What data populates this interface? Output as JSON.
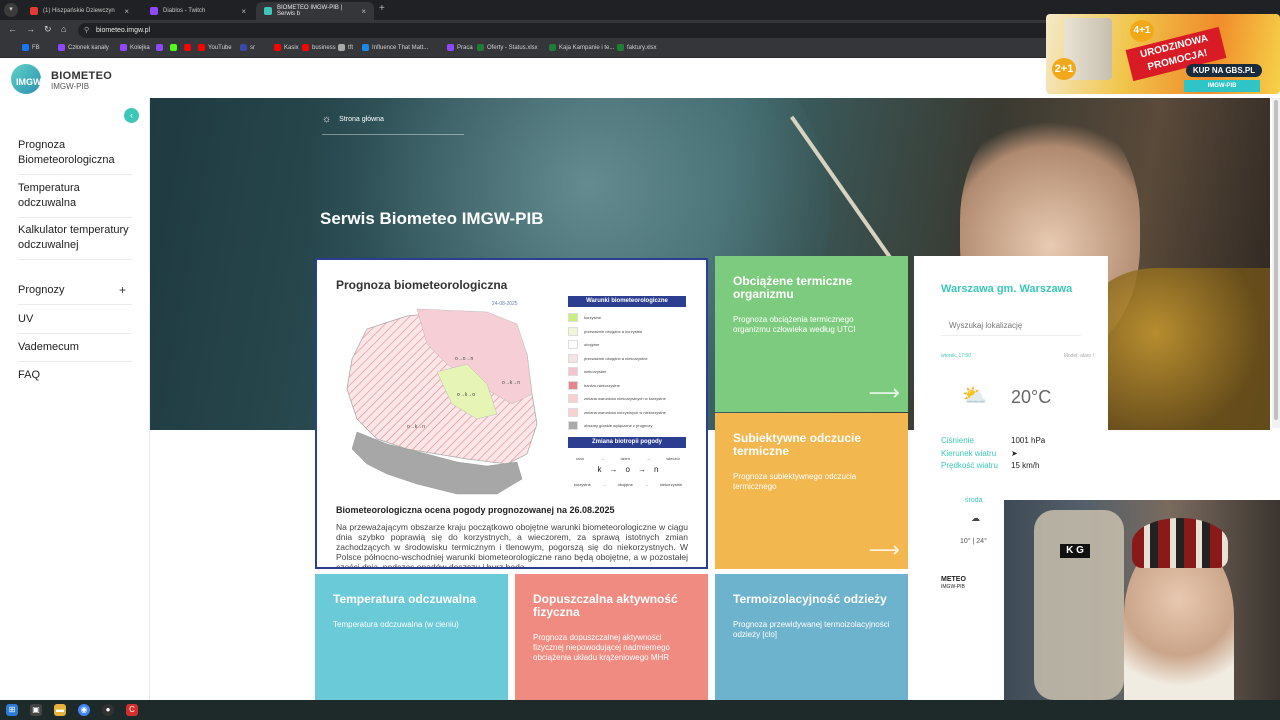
{
  "browser": {
    "tabs": [
      {
        "label": "(1) Hiszpańskie Dziewczyn",
        "color": "#e53935"
      },
      {
        "label": "Diablos - Twitch",
        "color": "#9146ff"
      },
      {
        "label": "BIOMETEO IMGW-PIB | Serwis b",
        "color": "#3cc7b8"
      }
    ],
    "url": "biometeo.imgw.pl",
    "bookmarks": [
      {
        "label": "FB",
        "color": "#1877f2"
      },
      {
        "label": "Członek kanały",
        "color": "#9146ff"
      },
      {
        "label": "Kolejka",
        "color": "#9146ff"
      },
      {
        "label": "",
        "color": "#9146ff"
      },
      {
        "label": "",
        "color": "#53fc18"
      },
      {
        "label": "",
        "color": "#ff0000"
      },
      {
        "label": "YouTube",
        "color": "#ff0000"
      },
      {
        "label": "sr",
        "color": "#3949ab"
      },
      {
        "label": "Kasix",
        "color": "#ff0000"
      },
      {
        "label": "business",
        "color": "#ff0000"
      },
      {
        "label": "tft",
        "color": "#aaaaaa"
      },
      {
        "label": "Influence That Matt...",
        "color": "#1e88e5"
      },
      {
        "label": "Praca",
        "color": "#9146ff"
      },
      {
        "label": "Oferty - Status.xlsx",
        "color": "#1e7e34"
      },
      {
        "label": "Kaja Kampanie i te...",
        "color": "#1e7e34"
      },
      {
        "label": "faktury.xlsx",
        "color": "#1e7e34"
      }
    ]
  },
  "site": {
    "logo_text": "BIOMETEO",
    "logo_sub": "IMGW-PIB",
    "logo_mark": "IMGW"
  },
  "sidebar": {
    "items": [
      {
        "label": "Prognoza Biometeorologiczna"
      },
      {
        "label": "Temperatura odczuwalna"
      },
      {
        "label": "Kalkulator temperatury odczuwalnej"
      },
      {
        "label": "Prognozy",
        "expand": "+"
      },
      {
        "label": "UV"
      },
      {
        "label": "Vademecum"
      },
      {
        "label": "FAQ"
      }
    ]
  },
  "hero": {
    "breadcrumb": "Strona główna",
    "title": "Serwis Biometeo IMGW-PIB"
  },
  "forecast": {
    "title": "Prognoza biometeorologiczna",
    "map_date": "24-08-2025",
    "legend_title": "Warunki biometeorologiczne",
    "legend": [
      {
        "label": "korzystne",
        "color": "#c8f07a"
      },
      {
        "label": "przeważnie obojętne a korzystne",
        "color": "#eef8d6"
      },
      {
        "label": "obojętne",
        "color": "#ffffff"
      },
      {
        "label": "przeważnie obojętne a niekorzystne",
        "color": "#f7e3e3"
      },
      {
        "label": "niekorzystne",
        "color": "#f4c4cc"
      },
      {
        "label": "bardzo niekorzystne",
        "color": "#e8848f"
      },
      {
        "label": "zmiana warunków niekorzystnych w korzystne",
        "color": "#f8d0d0"
      },
      {
        "label": "zmiana warunków korzystnych w niekorzystne",
        "color": "#f8d0d0"
      },
      {
        "label": "obszary górskie wyłączone z prognozy",
        "color": "#aaaaaa"
      }
    ],
    "bio_title": "Zmiana biotropii pogody",
    "bio_times": [
      "rano",
      "dzień",
      "wieczór"
    ],
    "bio_letters": [
      "k",
      "o",
      "n"
    ],
    "bio_labels": [
      "korzystne",
      "obojętne",
      "niekorzystne"
    ],
    "subtitle": "Biometeorologiczna ocena pogody prognozowanej na 26.08.2025",
    "body": "Na przeważającym obszarze kraju początkowo obojętne warunki biometeorologiczne w ciągu dnia szybko poprawią się do korzystnych, a wieczorem, za sprawą istotnych zmian zachodzących w środowisku termicznym i tlenowym, pogorszą się do niekorzystnych. W Polsce północno-wschodniej warunki biometeorologiczne rano będą obojętne, a w pozostałej części dnia, podczas opadów deszczu i burz będą"
  },
  "cards": {
    "load": {
      "title": "Obciążene termiczne organizmu",
      "desc": "Prognoza obciążenia termicznego organizmu człowieka według UTCI",
      "color": "#7dcb7e"
    },
    "subjective": {
      "title": "Subiektywne odczucie termiczne",
      "desc": "Prognoza subiektywnego odczucia termicznego",
      "color": "#f2b74f"
    },
    "temperature": {
      "title": "Temperatura odczuwalna",
      "desc": "Temperatura odczuwalna (w cieniu)",
      "color": "#6bcad7"
    },
    "activity": {
      "title": "Dopuszczalna aktywność fizyczna",
      "desc": "Prognoza dopuszczalnej aktywności fizycznej niepowodującej nadmiernego obciążenia układu krążeniowego MHR",
      "color": "#ef8b80"
    },
    "clothing": {
      "title": "Termoizolacyjność odzieży",
      "desc": "Prognoza przewidywanej termoizolacyjności odzieży [clo]",
      "color": "#6eb3cd"
    }
  },
  "weather": {
    "location": "Warszawa gm. Warszawa",
    "search_placeholder": "Wyszukaj lokalizację",
    "time": "wtorek, 17:00",
    "model": "Model: alaro I",
    "icon": "cloud-sun-icon",
    "temperature": "20°C",
    "pressure_label": "Ciśnienie",
    "pressure_value": "1001 hPa",
    "wind_dir_label": "Kierunek wiatru",
    "wind_dir_value": "➤",
    "wind_speed_label": "Prędkość wiatru",
    "wind_speed_value": "15 km/h",
    "day": "środa",
    "day_icon": "☁",
    "range": "10° | 24°",
    "brand1": "METEO",
    "brand2": "IMGW-PIB"
  },
  "promo": {
    "n1": "2+1",
    "n2": "4+1",
    "ribbon": "URODZINOWA PROMOCJA!",
    "button": "KUP NA GBS.PL",
    "bar": "IMGW-PIB"
  },
  "webcam": {
    "badge": "K G"
  }
}
